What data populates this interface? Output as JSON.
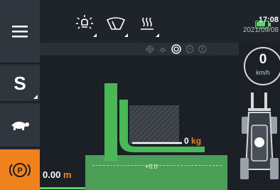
{
  "top_bar": {
    "time": "17:08",
    "date": "2021/09/08"
  },
  "left_panel": {
    "gear_letter": "S",
    "park_letter": "P"
  },
  "speed": {
    "value": "0",
    "unit": "km/h"
  },
  "implement": {
    "weight_value": "0",
    "weight_unit": "kg",
    "height_value": "0.00",
    "height_unit": "m",
    "angle_value": "+0.0",
    "angle_unit": "°"
  },
  "colors": {
    "accent": "#f0821e",
    "fork_green": "#4bb857",
    "ground_green": "#4b9f56",
    "battery": "#5fd46a"
  }
}
